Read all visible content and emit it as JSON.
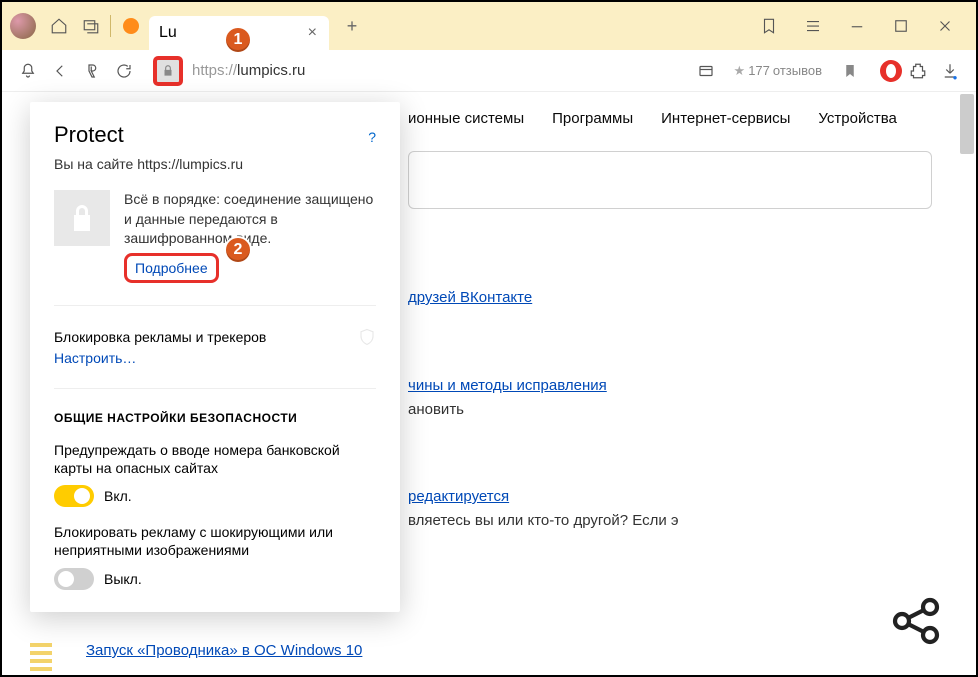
{
  "titlebar": {
    "tab_title": "Lu",
    "tab_close": "×",
    "new_tab": "+"
  },
  "toolbar": {
    "scheme": "https://",
    "host": "lumpics.ru",
    "reviews_count": "177",
    "reviews_word": "отзывов"
  },
  "nav": {
    "os_fragment": "ионные системы",
    "programs": "Программы",
    "services": "Интернет-сервисы",
    "devices": "Устройства"
  },
  "articles": {
    "a1": "друзей ВКонтакте",
    "a2": "чины и методы исправления",
    "a2_sub": "ановить",
    "a3": "редактируется",
    "a3_sub": "вляетесь вы или кто-то другой? Если э",
    "bottom": "Запуск «Проводника» в ОС Windows 10"
  },
  "protect": {
    "title": "Protect",
    "help": "?",
    "site_prefix": "Вы на сайте ",
    "site_url": "https://lumpics.ru",
    "status": "Всё в порядке: соединение защищено и данные передаются в зашифрованном виде.",
    "more": "Подробнее",
    "block_label": "Блокировка рекламы и трекеров",
    "configure": "Настроить…",
    "settings_heading": "ОБЩИЕ НАСТРОЙКИ БЕЗОПАСНОСТИ",
    "toggle1_label": "Предупреждать о вводе номера банковской карты на опасных сайтах",
    "toggle2_label": "Блокировать рекламу с шокирующими или неприятными изображениями",
    "on": "Вкл.",
    "off": "Выкл."
  },
  "badges": {
    "b1": "1",
    "b2": "2"
  }
}
